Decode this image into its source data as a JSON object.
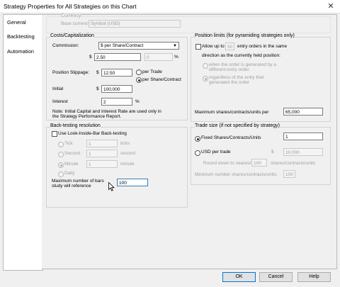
{
  "window": {
    "title": "Strategy Properties for All Strategies on this Chart",
    "close_glyph": "✕"
  },
  "tabs": [
    {
      "label": "General"
    },
    {
      "label": "Backtesting"
    },
    {
      "label": "Automation"
    }
  ],
  "currency": {
    "section": "Currency",
    "label": "Base currency",
    "value": "Symbol (USD)"
  },
  "costs": {
    "section": "Costs/Capitalization",
    "commission_label": "Commission:",
    "commission_type": "$ per Share/Contract",
    "dollar_sign": "$",
    "commission_value": "2.50",
    "percent_value": "0",
    "percent_sign": "%",
    "slippage_label": "Position Slippage:",
    "slippage_value": "12.50",
    "per_trade": "per Trade",
    "per_share": "per Share/Contract",
    "initial_label": "Initial",
    "initial_value": "100,000",
    "interest_label": "Interest",
    "interest_value": "2",
    "note_line1": "Note: Initial Capital and Interest Rate are used only in",
    "note_line2": "the Strategy Performance Report."
  },
  "position_limits": {
    "section": "Position limits (for pyramiding strategies only)",
    "allow_label": "Allow up to",
    "allow_value": "50",
    "entry_text": "entry orders in the same",
    "direction_text": "direction as the currently held position:",
    "opt1_line1": "when the order is generated by a",
    "opt1_line2": "different entry order",
    "opt2_line1": "regardless of the entry that",
    "opt2_line2": "generated the order",
    "max_label": "Maximum shares/contracts/units per",
    "max_value": "65,000"
  },
  "backtest_res": {
    "section": "Back-testing resolution",
    "lib_label": "Use Look-Inside-Bar Back-testing",
    "tick": "Tick",
    "tick_value": "1",
    "tick_unit": "ticks",
    "second": "Second",
    "second_value": "1",
    "second_unit": "second",
    "minute": "Minute",
    "minute_value": "1",
    "minute_unit": "minute",
    "daily": "Daily",
    "maxbars_line1": "Maximum number of bars",
    "maxbars_line2": "study will reference",
    "maxbars_value": "100"
  },
  "trade_size": {
    "section": "Trade size (if not specified by strategy)",
    "fixed_label": "Fixed Shares/Contracts/Units",
    "fixed_value": "1",
    "usd_label": "USD per trade",
    "dollar_sign": "$",
    "usd_value": "10,000",
    "round_label": "Round down to nearest",
    "round_value": "100",
    "round_unit": "shares/contracts/units",
    "min_label": "Minimum number shares/contracts/units:",
    "min_value": "100"
  },
  "buttons": {
    "ok": "OK",
    "cancel": "Cancel",
    "help": "Help"
  },
  "colors": {
    "accent": "#0078d7",
    "disabled_text": "#a0a0a0"
  }
}
